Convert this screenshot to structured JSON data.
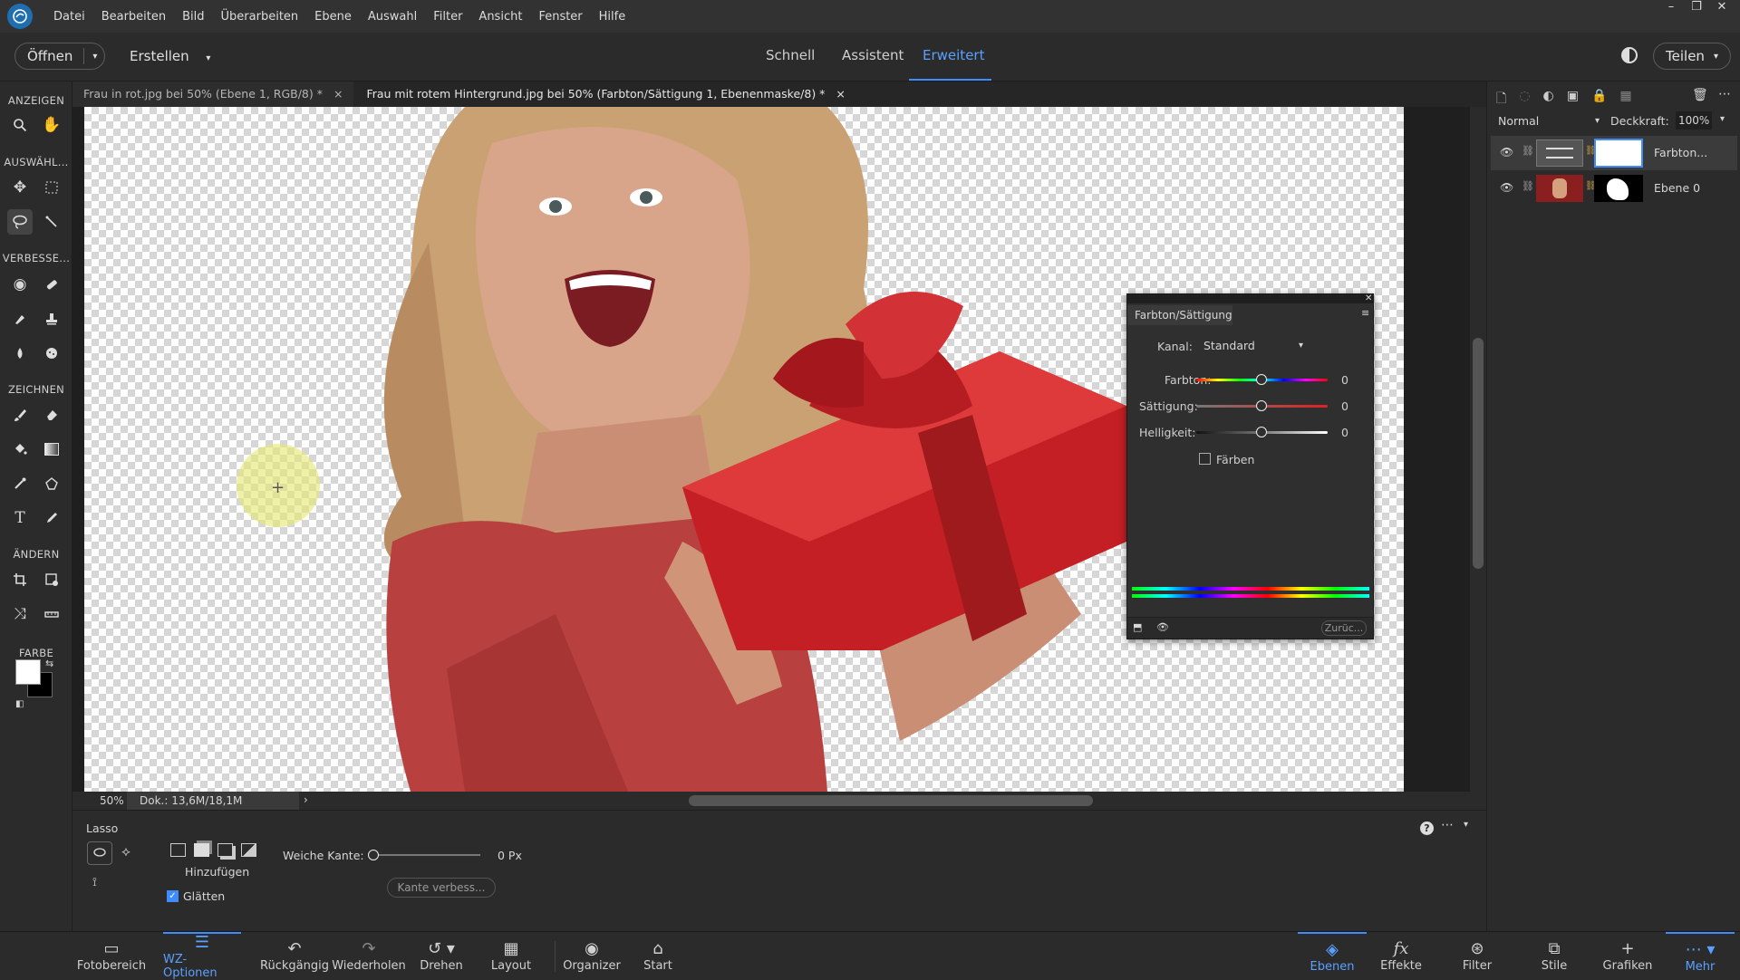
{
  "app": {
    "menu": [
      "Datei",
      "Bearbeiten",
      "Bild",
      "Überarbeiten",
      "Ebene",
      "Auswahl",
      "Filter",
      "Ansicht",
      "Fenster",
      "Hilfe"
    ],
    "window_controls": [
      "–",
      "❐",
      "✕"
    ]
  },
  "modebar": {
    "open_label": "Öffnen",
    "create_label": "Erstellen",
    "modes": [
      "Schnell",
      "Assistent",
      "Erweitert"
    ],
    "active_mode": "Erweitert",
    "share_label": "Teilen"
  },
  "toolbar": {
    "sections": [
      "ANZEIGEN",
      "AUSWÄHL...",
      "VERBESSE...",
      "ZEICHNEN",
      "ÄNDERN",
      "FARBE"
    ]
  },
  "doc_tabs": [
    {
      "label": "Frau in rot.jpg bei 50% (Ebene 1, RGB/8) *",
      "close": "×"
    },
    {
      "label": "Frau mit rotem Hintergrund.jpg bei 50% (Farbton/Sättigung 1, Ebenenmaske/8) *",
      "close": "×"
    }
  ],
  "status": {
    "zoom": "50%",
    "doc": "Dok.: 13,6M/18,1M",
    "arrow": "›"
  },
  "tool_options": {
    "tool_name": "Lasso",
    "mode_label": "Hinzufügen",
    "feather_label": "Weiche Kante:",
    "feather_value": "0 Px",
    "feather_level": 0,
    "refine_button": "Kante verbess...",
    "smooth_label": "Glätten",
    "smooth_checked": true
  },
  "layers_panel": {
    "blend_mode": "Normal",
    "opacity_label": "Deckkraft:",
    "opacity_value": "100%",
    "layers": [
      {
        "name": "Farbton...",
        "selected": true
      },
      {
        "name": "Ebene 0",
        "selected": false
      }
    ]
  },
  "huesat": {
    "title": "Farbton/Sättigung",
    "channel_label": "Kanal:",
    "channel_value": "Standard",
    "hue_label": "Farbton:",
    "hue_value": "0",
    "sat_label": "Sättigung:",
    "sat_value": "0",
    "light_label": "Helligkeit:",
    "light_value": "0",
    "colorize_label": "Färben",
    "colorize_checked": false,
    "reset_label": "Zurüc..."
  },
  "bottombar": {
    "left": [
      {
        "label": "Fotobereich",
        "icon": "photo-bin-icon"
      },
      {
        "label": "WZ-Optionen",
        "icon": "tool-options-icon",
        "active": true
      },
      {
        "label": "Rückgängig",
        "icon": "undo-icon"
      },
      {
        "label": "Wiederholen",
        "icon": "redo-icon"
      },
      {
        "label": "Drehen",
        "icon": "rotate-icon"
      },
      {
        "label": "Layout",
        "icon": "layout-icon"
      },
      {
        "label": "Organizer",
        "icon": "organizer-icon"
      },
      {
        "label": "Start",
        "icon": "home-icon"
      }
    ],
    "right": [
      {
        "label": "Ebenen",
        "icon": "layers-icon",
        "active": true
      },
      {
        "label": "Effekte",
        "icon": "effects-icon"
      },
      {
        "label": "Filter",
        "icon": "filter-icon"
      },
      {
        "label": "Stile",
        "icon": "styles-icon"
      },
      {
        "label": "Grafiken",
        "icon": "graphics-icon"
      },
      {
        "label": "Mehr",
        "icon": "more-icon"
      }
    ]
  },
  "colors": {
    "accent": "#3f8cff",
    "foreground_swatch": "#ffffff",
    "background_swatch": "#000000"
  }
}
